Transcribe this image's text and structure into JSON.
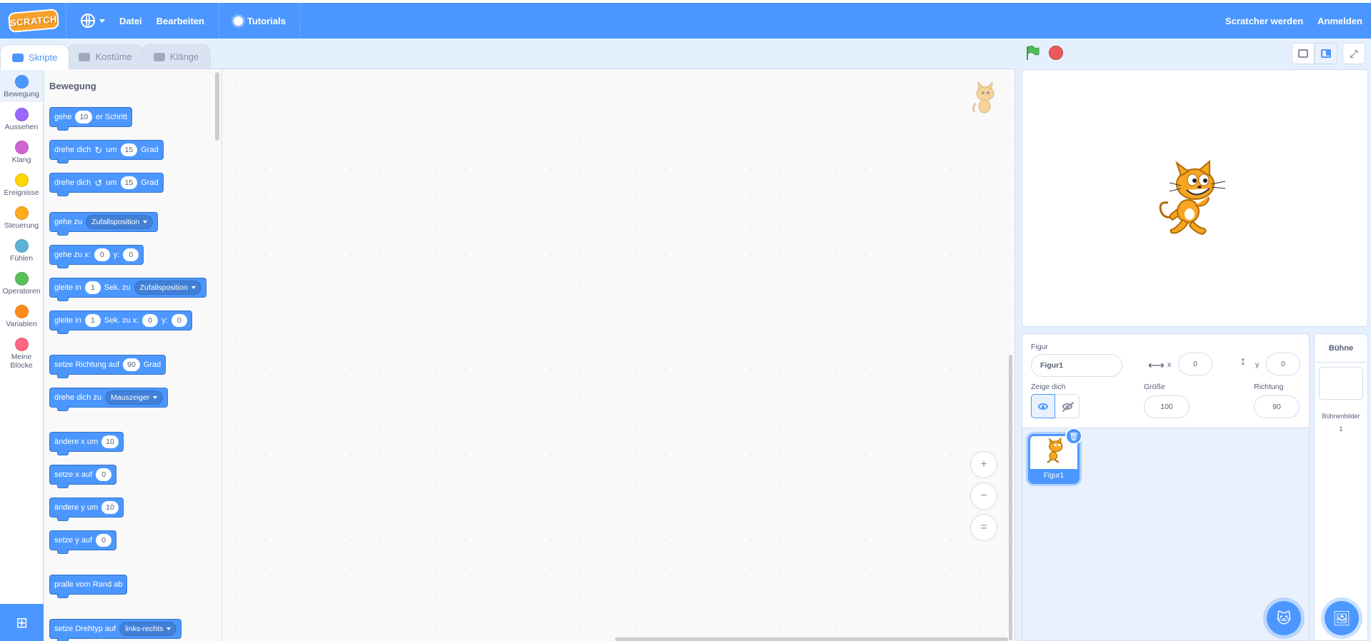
{
  "menubar": {
    "logo": "SCRATCH",
    "file": "Datei",
    "edit": "Bearbeiten",
    "tutorials": "Tutorials",
    "join": "Scratcher werden",
    "signin": "Anmelden"
  },
  "tabs": {
    "code": "Skripte",
    "costumes": "Kostüme",
    "sounds": "Klänge"
  },
  "categories": [
    {
      "label": "Bewegung",
      "color": "#4c97ff"
    },
    {
      "label": "Aussehen",
      "color": "#9966ff"
    },
    {
      "label": "Klang",
      "color": "#cf63cf"
    },
    {
      "label": "Ereignisse",
      "color": "#ffd500"
    },
    {
      "label": "Steuerung",
      "color": "#ffab19"
    },
    {
      "label": "Fühlen",
      "color": "#5cb1d6"
    },
    {
      "label": "Operatoren",
      "color": "#59c059"
    },
    {
      "label": "Variablen",
      "color": "#ff8c1a"
    },
    {
      "label": "Meine Blöcke",
      "color": "#ff6680"
    }
  ],
  "palette": {
    "title": "Bewegung",
    "b1": {
      "t1": "gehe",
      "v1": "10",
      "t2": "er Schritt"
    },
    "b2": {
      "t1": "drehe dich",
      "t2": "um",
      "v1": "15",
      "t3": "Grad"
    },
    "b3": {
      "t1": "drehe dich",
      "t2": "um",
      "v1": "15",
      "t3": "Grad"
    },
    "b4": {
      "t1": "gehe zu",
      "d1": "Zufallsposition"
    },
    "b5": {
      "t1": "gehe zu x:",
      "v1": "0",
      "t2": "y:",
      "v2": "0"
    },
    "b6": {
      "t1": "gleite in",
      "v1": "1",
      "t2": "Sek. zu",
      "d1": "Zufallsposition"
    },
    "b7": {
      "t1": "gleite in",
      "v1": "1",
      "t2": "Sek. zu x:",
      "v2": "0",
      "t3": "y:",
      "v3": "0"
    },
    "b8": {
      "t1": "setze Richtung auf",
      "v1": "90",
      "t2": "Grad"
    },
    "b9": {
      "t1": "drehe dich zu",
      "d1": "Mauszeiger"
    },
    "b10": {
      "t1": "ändere x um",
      "v1": "10"
    },
    "b11": {
      "t1": "setze x auf",
      "v1": "0"
    },
    "b12": {
      "t1": "ändere y um",
      "v1": "10"
    },
    "b13": {
      "t1": "setze y auf",
      "v1": "0"
    },
    "b14": {
      "t1": "pralle vom Rand ab"
    },
    "b15": {
      "t1": "setze Drehtyp auf",
      "d1": "links-rechts"
    }
  },
  "sprite_info": {
    "sprite_label": "Figur",
    "sprite_name": "Figur1",
    "x_label": "x",
    "x_value": "0",
    "y_label": "y",
    "y_value": "0",
    "show_label": "Zeige dich",
    "size_label": "Größe",
    "size_value": "100",
    "direction_label": "Richtung",
    "direction_value": "90"
  },
  "sprites": [
    {
      "name": "Figur1"
    }
  ],
  "stage_pane": {
    "title": "Bühne",
    "backdrops_label": "Bühnenbilder",
    "backdrops_count": "1"
  },
  "zoom": {
    "in": "+",
    "out": "−",
    "reset": "="
  },
  "colors": {
    "accent": "#4c97ff",
    "motion": "#4c97ff",
    "stop": "#ec5959",
    "flag": "#4cbf56"
  }
}
